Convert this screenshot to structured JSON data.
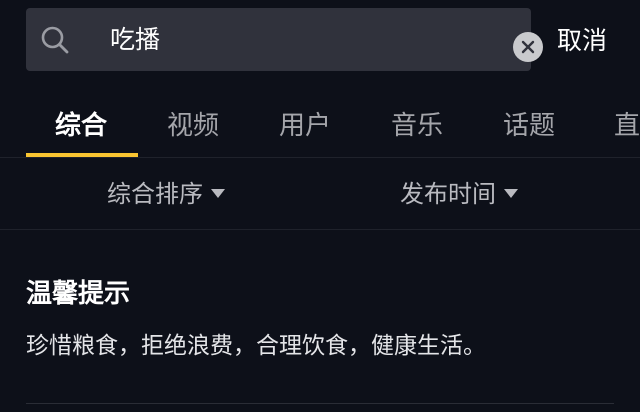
{
  "search": {
    "value": "吃播",
    "cancel_label": "取消"
  },
  "tabs": [
    {
      "label": "综合",
      "active": true
    },
    {
      "label": "视频",
      "active": false
    },
    {
      "label": "用户",
      "active": false
    },
    {
      "label": "音乐",
      "active": false
    },
    {
      "label": "话题",
      "active": false
    },
    {
      "label": "直",
      "active": false
    }
  ],
  "filters": {
    "sort_label": "综合排序",
    "time_label": "发布时间"
  },
  "tip": {
    "title": "温馨提示",
    "body": "珍惜粮食，拒绝浪费，合理饮食，健康生活。"
  },
  "colors": {
    "background": "#0d1019",
    "search_box": "#30323c",
    "accent": "#f9c531",
    "inactive_text": "#a4a5aa"
  },
  "icons": {
    "search": "search-icon",
    "clear": "close-circle-icon",
    "dropdown": "caret-down-icon"
  }
}
